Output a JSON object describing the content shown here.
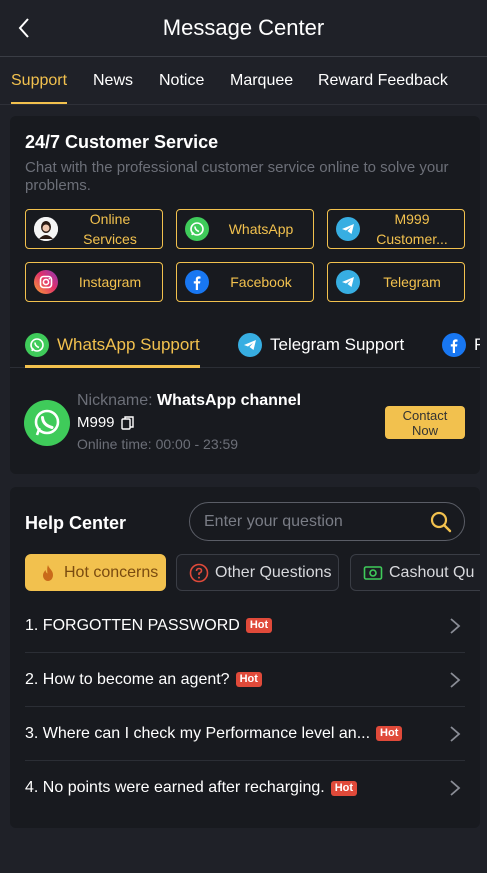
{
  "header": {
    "title": "Message Center"
  },
  "tabs": [
    {
      "label": "Support",
      "active": true
    },
    {
      "label": "News"
    },
    {
      "label": "Notice"
    },
    {
      "label": "Marquee"
    },
    {
      "label": "Reward Feedback"
    }
  ],
  "customer_service": {
    "title": "24/7 Customer Service",
    "description": "Chat with the professional customer service online to solve your problems.",
    "buttons": [
      {
        "label_line1": "Online",
        "label_line2": "Services",
        "icon": "avatar-icon"
      },
      {
        "label": "WhatsApp",
        "icon": "whatsapp-icon"
      },
      {
        "label_line1": "M999",
        "label_line2": "Customer...",
        "icon": "telegram-icon"
      },
      {
        "label": "Instagram",
        "icon": "instagram-icon"
      },
      {
        "label": "Facebook",
        "icon": "facebook-icon"
      },
      {
        "label": "Telegram",
        "icon": "telegram-icon"
      }
    ]
  },
  "support_tabs": [
    {
      "label": "WhatsApp Support",
      "active": true,
      "icon": "whatsapp-icon"
    },
    {
      "label": "Telegram Support",
      "icon": "telegram-icon"
    },
    {
      "label": "F",
      "icon": "facebook-icon"
    }
  ],
  "channel": {
    "nickname_label": "Nickname:",
    "nickname": "WhatsApp channel",
    "id": "M999",
    "online_time": "Online time: 00:00 - 23:59",
    "contact_line1": "Contact",
    "contact_line2": "Now"
  },
  "help": {
    "title": "Help Center",
    "search_placeholder": "Enter your question",
    "categories": [
      {
        "label": "Hot concerns",
        "active": true,
        "icon": "fire-icon"
      },
      {
        "label": "Other Questions",
        "icon": "question-icon"
      },
      {
        "label": "Cashout Qu",
        "icon": "cash-icon"
      }
    ],
    "hot_label": "Hot",
    "questions": [
      {
        "text": "1. FORGOTTEN PASSWORD",
        "hot": true
      },
      {
        "text": "2. How to become an agent?",
        "hot": true
      },
      {
        "text": "3. Where can I check my Performance level an...",
        "hot": true
      },
      {
        "text": "4. No points were earned after recharging.",
        "hot": true
      }
    ]
  },
  "colors": {
    "accent": "#f2c14e",
    "background": "#1f2128",
    "card": "#181a1f",
    "hot": "#e04a3a",
    "whatsapp": "#3fcb5a",
    "telegram": "#37aee2",
    "facebook": "#1877f2"
  }
}
